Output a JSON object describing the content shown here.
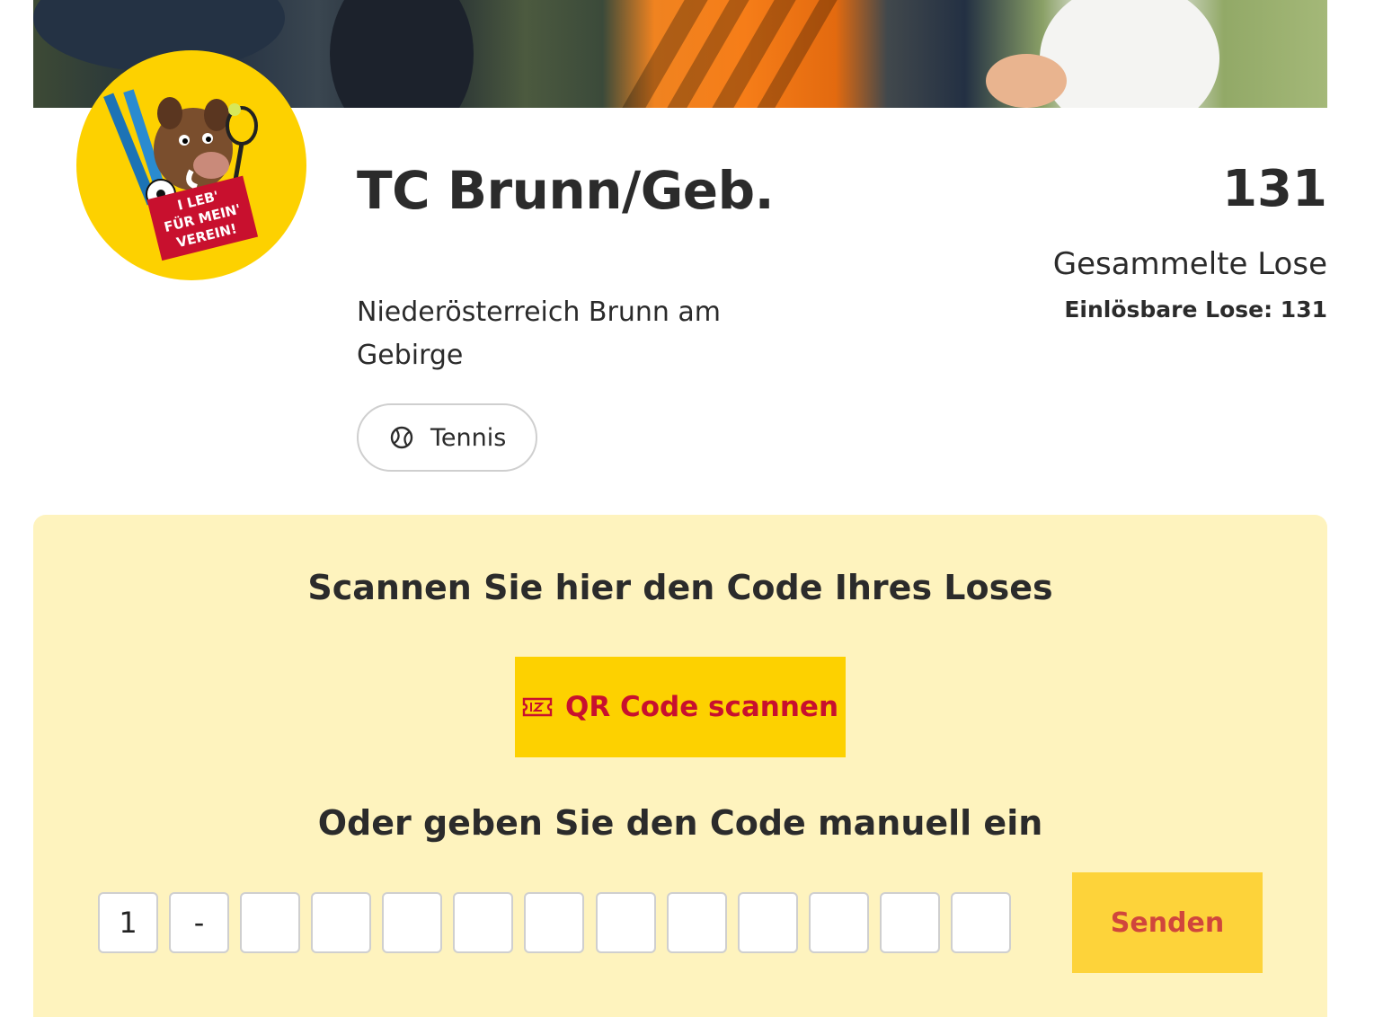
{
  "club": {
    "name": "TC Brunn/Geb.",
    "location": "Niederösterreich Brunn am Gebirge",
    "sport": "Tennis",
    "sport_icon": "tennis-ball-icon",
    "logo_text": [
      "I LEB'",
      "FÜR MEIN'",
      "VEREIN!"
    ]
  },
  "stats": {
    "total": "131",
    "total_label": "Gesammelte Lose",
    "redeemable": "Einlösbare Lose: 131"
  },
  "scan": {
    "title": "Scannen Sie hier den Code Ihres Loses",
    "qr_button_label": "QR Code scannen",
    "qr_button_icon": "ticket-icon",
    "manual_title": "Oder geben Sie den Code manuell ein",
    "code_values": [
      "1",
      "-",
      "",
      "",
      "",
      "",
      "",
      "",
      "",
      "",
      "",
      "",
      ""
    ],
    "send_label": "Senden"
  },
  "colors": {
    "brand_yellow": "#fdd100",
    "panel_bg": "#fef3be",
    "accent_red": "#c8102e"
  }
}
